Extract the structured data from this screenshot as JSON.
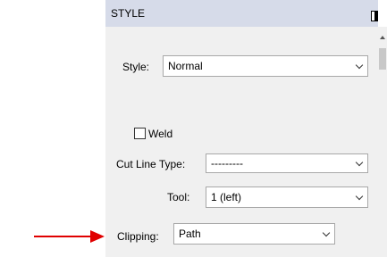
{
  "panel": {
    "title": "STYLE"
  },
  "fields": {
    "style": {
      "label": "Style:",
      "value": "Normal"
    },
    "weld": {
      "label": "Weld",
      "checked": false
    },
    "cut_line_type": {
      "label": "Cut Line Type:",
      "value": "---------"
    },
    "tool": {
      "label": "Tool:",
      "value": "1 (left)"
    },
    "clipping": {
      "label": "Clipping:",
      "value": "Path"
    }
  },
  "annotation": {
    "arrow_color": "#e00000"
  },
  "colors": {
    "header_bg": "#d6dbe9",
    "panel_bg": "#f0f0f0"
  }
}
